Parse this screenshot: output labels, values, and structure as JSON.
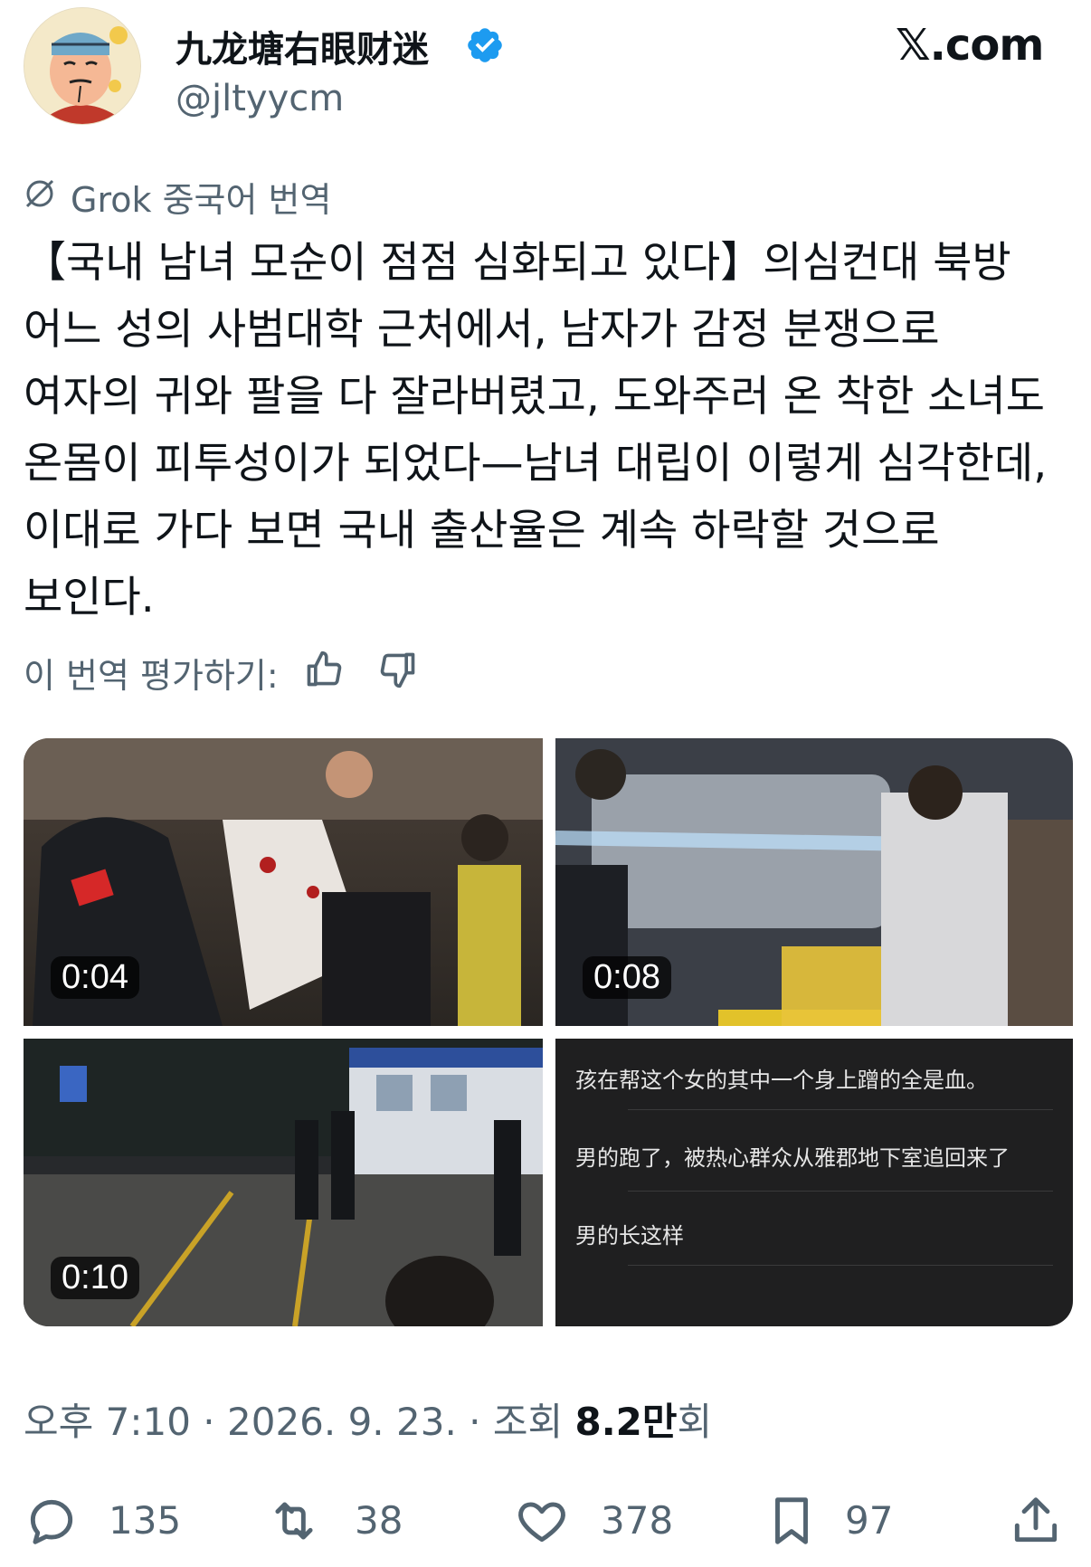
{
  "header": {
    "display_name": "九龙塘右眼财迷",
    "handle": "@jltyycm",
    "site": "𝕏.com"
  },
  "translation": {
    "label": "Grok 중국어 번역",
    "text": "【국내 남녀 모순이 점점 심화되고 있다】의심컨대 북방 어느 성의 사범대학 근처에서, 남자가 감정 분쟁으로 여자의 귀와 팔을 다 잘라버렸고, 도와주러 온 착한 소녀도 온몸이 피투성이가 되었다—남녀 대립이 이렇게 심각한데, 이대로 가다 보면 국내 출산율은 계속 하락할 것으로 보인다.",
    "rate_label": "이 번역 평가하기:"
  },
  "media": [
    {
      "duration": "0:04"
    },
    {
      "duration": "0:08"
    },
    {
      "duration": "0:10"
    },
    {
      "lines": [
        "孩在帮这个女的其中一个身上蹭的全是血。",
        "男的跑了，被热心群众从雅郡地下室追回来了",
        "男的长这样"
      ]
    }
  ],
  "meta": {
    "time": "오후 7:10 · 2026. 9. 23. · 조회 ",
    "views": "8.2만",
    "views_suffix": "회"
  },
  "actions": {
    "replies": "135",
    "reposts": "38",
    "likes": "378",
    "bookmarks": "97"
  },
  "icons": [
    "avatar",
    "verified-icon",
    "grok-icon",
    "thumbs-up-icon",
    "thumbs-down-icon",
    "reply-icon",
    "repost-icon",
    "like-icon",
    "bookmark-icon",
    "share-icon"
  ],
  "colors": {
    "accent": "#1d9bf0",
    "muted": "#536471",
    "text": "#0f1419"
  }
}
